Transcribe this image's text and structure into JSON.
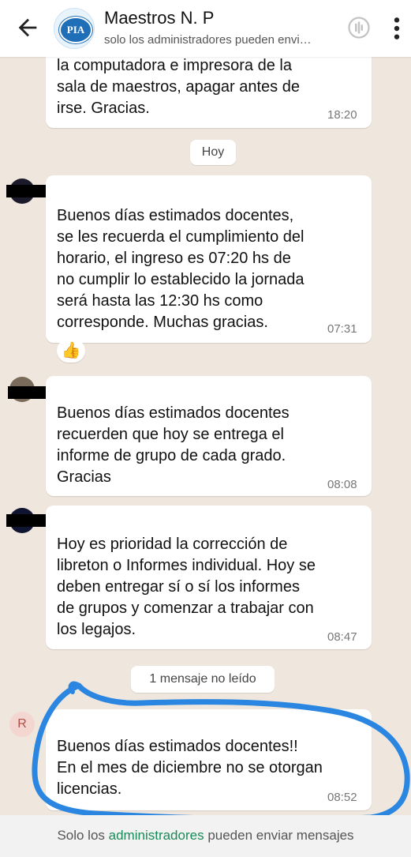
{
  "header": {
    "back_icon": "arrow-left-icon",
    "avatar_text": "PIA",
    "title": "Maestros N. P",
    "subtitle": "solo los administradores pueden envi…",
    "call_icon": "call-plus-icon",
    "more_icon": "more-vertical-icon"
  },
  "messages": [
    {
      "text": "la computadora e impresora de la\nsala de maestros,  apagar antes de\nirse. Gracias.",
      "time": "18:20"
    },
    {
      "text": "Buenos días estimados docentes,\nse les recuerda el cumplimiento del\nhorario, el ingreso es 07:20 hs de\nno cumplir lo establecido la jornada\nserá hasta las 12:30 hs como\ncorresponde. Muchas gracias.",
      "time": "07:31",
      "reaction": "👍"
    },
    {
      "text": "Buenos días estimados docentes\nrecuerden que hoy se entrega el\ninforme de grupo de cada grado.\nGracias",
      "time": "08:08"
    },
    {
      "text": "Hoy es prioridad la corrección de\nlibreton o Informes individual. Hoy se\ndeben entregar  sí o sí los informes\nde grupos y comenzar a trabajar con\nlos legajos.",
      "time": "08:47"
    },
    {
      "text": "Buenos días estimados docentes!!\nEn el mes de diciembre no se otorgan\nlicencias.",
      "time": "08:52",
      "avatar_letter": "R"
    }
  ],
  "date_divider": "Hoy",
  "unread_divider": "1 mensaje no leído",
  "footer": {
    "prefix": "Solo los ",
    "link": "administradores",
    "suffix": " pueden enviar mensajes"
  },
  "colors": {
    "chat_bg": "#efe7dd",
    "link_green": "#1b8a5a",
    "annotation_blue": "#2a86e0"
  }
}
